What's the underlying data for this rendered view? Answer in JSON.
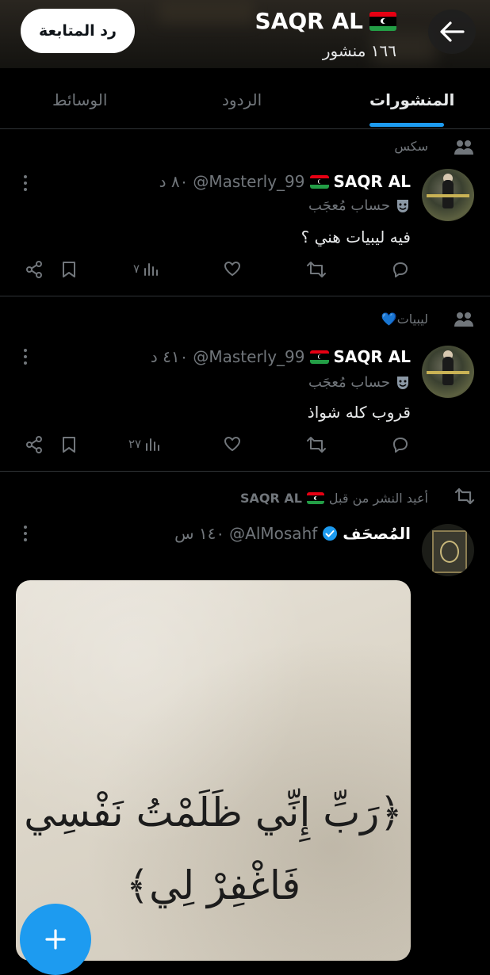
{
  "header": {
    "name": "SAQR AL",
    "post_count": "١٦٦ منشور",
    "follow_back_label": "رد المتابعة"
  },
  "tabs": [
    {
      "label": "المنشورات",
      "active": true
    },
    {
      "label": "الردود",
      "active": false
    },
    {
      "label": "الوسائط",
      "active": false
    }
  ],
  "posts": [
    {
      "context": "سكس",
      "author_name": "SAQR AL",
      "handle": "@Masterly_99",
      "time": "٨٠ د",
      "label": "حساب مُعجَب",
      "text": "فيه ليبيات هني ؟",
      "views": "٧"
    },
    {
      "context": "ليبيات💙",
      "author_name": "SAQR AL",
      "handle": "@Masterly_99",
      "time": "٤١٠ د",
      "label": "حساب مُعجَب",
      "text": "قروب كله شواذ",
      "views": "٢٧"
    },
    {
      "context": "أعيد النشر من قبل",
      "context_name": "SAQR AL",
      "author_name": "المُصحَف",
      "handle": "@AlMosahf",
      "time": "١٤٠ س",
      "verified": true,
      "media_line1": "﴿رَبِّ إِنِّي ظَلَمْتُ نَفْسِي",
      "media_line2": "فَاغْفِرْ لِي﴾"
    }
  ],
  "colors": {
    "accent": "#1d9bf0",
    "background": "#000000",
    "muted": "#71767b",
    "text": "#e7e9ea"
  }
}
